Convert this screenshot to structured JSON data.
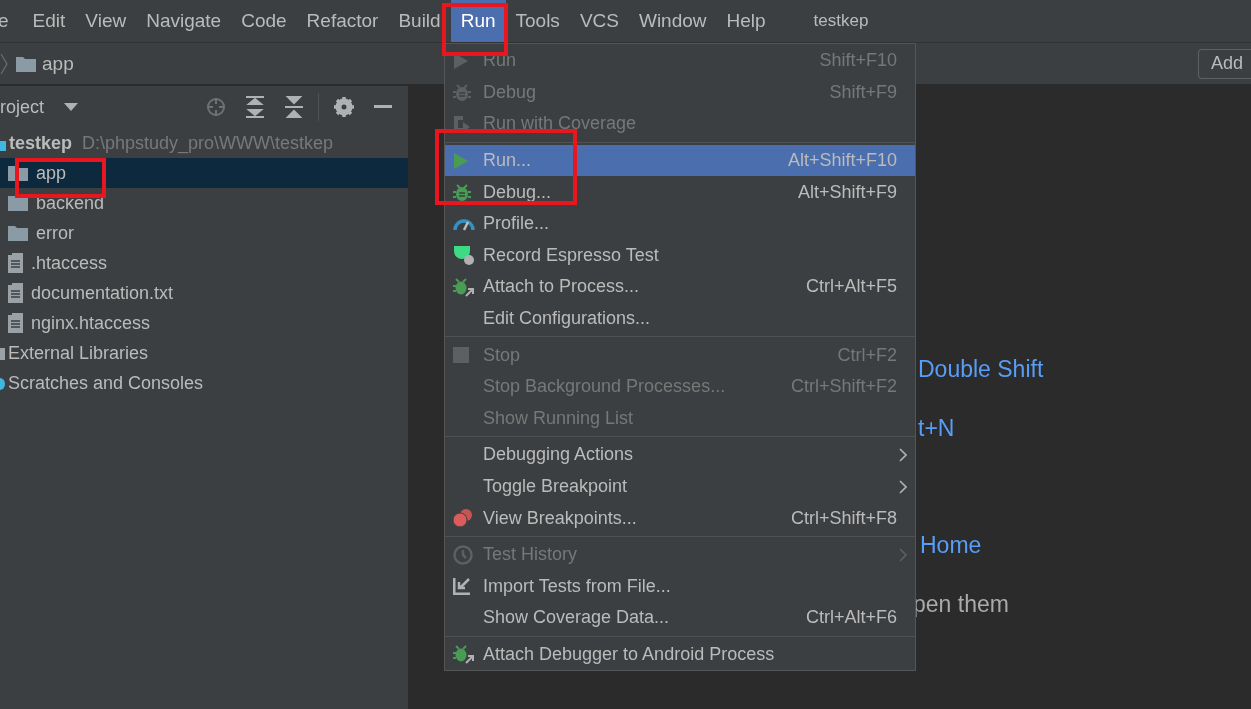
{
  "menu_bar": {
    "items": [
      {
        "label": "e",
        "selected": false
      },
      {
        "label": "Edit",
        "selected": false
      },
      {
        "label": "View",
        "selected": false
      },
      {
        "label": "Navigate",
        "selected": false
      },
      {
        "label": "Code",
        "selected": false
      },
      {
        "label": "Refactor",
        "selected": false
      },
      {
        "label": "Build",
        "selected": false
      },
      {
        "label": "Run",
        "selected": true
      },
      {
        "label": "Tools",
        "selected": false
      },
      {
        "label": "VCS",
        "selected": false
      },
      {
        "label": "Window",
        "selected": false
      },
      {
        "label": "Help",
        "selected": false
      }
    ],
    "title": "testkep"
  },
  "nav_bar": {
    "breadcrumb": "app",
    "button": "Add"
  },
  "project_panel": {
    "title": "roject",
    "tree": [
      {
        "label": "testkep",
        "path": "D:\\phpstudy_pro\\WWW\\testkep",
        "kind": "module",
        "selected": false,
        "children": [
          {
            "label": "app",
            "kind": "folder",
            "selected": true
          },
          {
            "label": "backend",
            "kind": "folder",
            "selected": false
          },
          {
            "label": "error",
            "kind": "folder",
            "selected": false
          },
          {
            "label": ".htaccess",
            "kind": "file",
            "selected": false
          },
          {
            "label": "documentation.txt",
            "kind": "file",
            "selected": false
          },
          {
            "label": "nginx.htaccess",
            "kind": "file",
            "selected": false
          }
        ]
      },
      {
        "label": "External Libraries",
        "kind": "library",
        "selected": false
      },
      {
        "label": "Scratches and Consoles",
        "kind": "scratch",
        "selected": false
      }
    ]
  },
  "editor_hints": [
    {
      "text": "Double Shift",
      "kind": "link"
    },
    {
      "text": "t+N",
      "kind": "link"
    },
    {
      "text": "Home",
      "kind": "link"
    },
    {
      "text": "pen them",
      "kind": "plain"
    }
  ],
  "run_menu": [
    {
      "kind": "item",
      "label": "Run",
      "shortcut": "Shift+F10",
      "disabled": true,
      "selected": false,
      "submenu": false
    },
    {
      "kind": "item",
      "label": "Debug",
      "shortcut": "Shift+F9",
      "disabled": true,
      "selected": false,
      "submenu": false
    },
    {
      "kind": "item",
      "label": "Run with Coverage",
      "disabled": true,
      "selected": false,
      "submenu": false
    },
    {
      "kind": "separator"
    },
    {
      "kind": "item",
      "label": "Run...",
      "shortcut": "Alt+Shift+F10",
      "disabled": false,
      "selected": true,
      "submenu": false
    },
    {
      "kind": "item",
      "label": "Debug...",
      "shortcut": "Alt+Shift+F9",
      "disabled": false,
      "selected": false,
      "submenu": false
    },
    {
      "kind": "item",
      "label": "Profile...",
      "disabled": false,
      "selected": false,
      "submenu": false
    },
    {
      "kind": "item",
      "label": "Record Espresso Test",
      "disabled": false,
      "selected": false,
      "submenu": false
    },
    {
      "kind": "item",
      "label": "Attach to Process...",
      "shortcut": "Ctrl+Alt+F5",
      "disabled": false,
      "selected": false,
      "submenu": false
    },
    {
      "kind": "item",
      "label": "Edit Configurations...",
      "disabled": false,
      "selected": false,
      "submenu": false
    },
    {
      "kind": "separator"
    },
    {
      "kind": "item",
      "label": "Stop",
      "shortcut": "Ctrl+F2",
      "disabled": true,
      "selected": false,
      "submenu": false
    },
    {
      "kind": "item",
      "label": "Stop Background Processes...",
      "shortcut": "Ctrl+Shift+F2",
      "disabled": true,
      "selected": false,
      "submenu": false
    },
    {
      "kind": "item",
      "label": "Show Running List",
      "disabled": true,
      "selected": false,
      "submenu": false
    },
    {
      "kind": "separator"
    },
    {
      "kind": "item",
      "label": "Debugging Actions",
      "disabled": false,
      "selected": false,
      "submenu": true
    },
    {
      "kind": "item",
      "label": "Toggle Breakpoint",
      "disabled": false,
      "selected": false,
      "submenu": true
    },
    {
      "kind": "item",
      "label": "View Breakpoints...",
      "shortcut": "Ctrl+Shift+F8",
      "disabled": false,
      "selected": false,
      "submenu": false
    },
    {
      "kind": "separator"
    },
    {
      "kind": "item",
      "label": "Test History",
      "disabled": true,
      "selected": false,
      "submenu": true
    },
    {
      "kind": "item",
      "label": "Import Tests from File...",
      "disabled": false,
      "selected": false,
      "submenu": false
    },
    {
      "kind": "item",
      "label": "Show Coverage Data...",
      "shortcut": "Ctrl+Alt+F6",
      "disabled": false,
      "selected": false,
      "submenu": false
    },
    {
      "kind": "separator"
    },
    {
      "kind": "item",
      "label": "Attach Debugger to Android Process",
      "disabled": false,
      "selected": false,
      "submenu": false
    }
  ]
}
